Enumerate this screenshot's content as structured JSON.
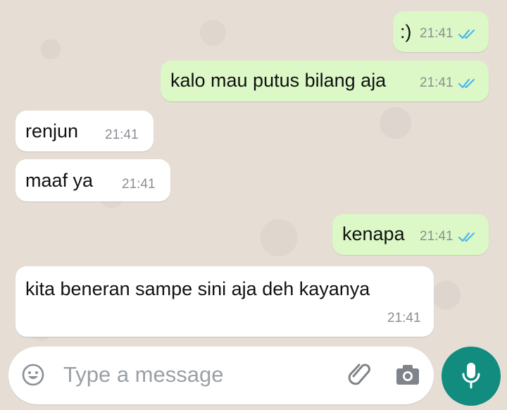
{
  "messages": [
    {
      "direction": "out",
      "text": ":)",
      "time": "21:41"
    },
    {
      "direction": "out",
      "text": "kalo mau putus bilang aja",
      "time": "21:41"
    },
    {
      "direction": "in",
      "text": "renjun",
      "time": "21:41"
    },
    {
      "direction": "in",
      "text": "maaf ya",
      "time": "21:41"
    },
    {
      "direction": "out",
      "text": "kenapa",
      "time": "21:41"
    },
    {
      "direction": "in",
      "text": "kita beneran sampe sini aja deh kayanya",
      "time": "21:41"
    }
  ],
  "composer": {
    "placeholder": "Type a message"
  },
  "icons": {
    "emoji": "emoji-icon",
    "attach": "paperclip-icon",
    "camera": "camera-icon",
    "mic": "microphone-icon",
    "read_receipt": "double-check-icon"
  },
  "colors": {
    "outgoing_bubble": "#dcf8c6",
    "incoming_bubble": "#ffffff",
    "read_tick": "#4fb6ec",
    "mic_button": "#128c7e",
    "background": "#e5ddd5"
  }
}
